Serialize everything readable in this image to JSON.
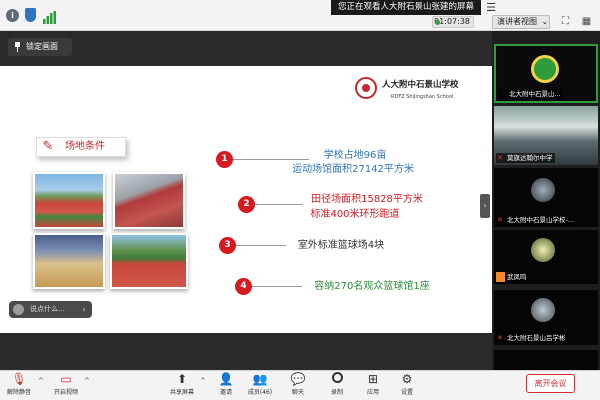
{
  "top_bar": {
    "share_banner": "您正在观看人大附石景山张建的屏幕",
    "timer": "01:07:38",
    "view_button": "演讲者视图",
    "view_caret": "⌄",
    "menu_icon": "☰",
    "info_icon": "i",
    "shield_icon": "shield",
    "signal_icon": "signal-bars",
    "fullscreen_icon": "⛶",
    "grid_icon": "▦"
  },
  "slide": {
    "lock_button": "锁定画面",
    "lock_icon": "📌",
    "school_name": "人大附中石景山学校",
    "school_name_en": "RDFZ Shijingshan School",
    "heading": "场地条件",
    "heading_icon": "✎",
    "points": [
      {
        "number": "1",
        "lines": [
          "学校占地96亩",
          "运动场馆面积27142平方米"
        ],
        "color": "#2f74c0"
      },
      {
        "number": "2",
        "lines": [
          "田径场面积15828平方米",
          "标准400米环形跑道"
        ],
        "color": "#d71920"
      },
      {
        "number": "3",
        "lines": [
          "室外标准篮球场4块"
        ],
        "color": "#333333"
      },
      {
        "number": "4",
        "lines": [
          "容纳270名观众篮球馆1座"
        ],
        "color": "#2e8b3a"
      }
    ]
  },
  "chat": {
    "placeholder": "说点什么...",
    "arrow": "‹"
  },
  "panel_toggle": "›",
  "participants": [
    {
      "name": "北大附中石景山...",
      "muted": false
    },
    {
      "name": "莫旗达翰尔中学",
      "muted": true
    },
    {
      "name": "北大附中石景山学校-...",
      "muted": true
    },
    {
      "name": "武凤鸣",
      "muted": false
    },
    {
      "name": "北大附石景山吕学彬",
      "muted": true
    },
    {
      "name": "",
      "muted": false
    }
  ],
  "toolbar": {
    "unmute": "解除静音",
    "start_video": "开启视频",
    "share_screen": "共享屏幕",
    "invite": "邀请",
    "members": "成员(46)",
    "chat": "聊天",
    "record": "录制",
    "apps": "应用",
    "settings": "设置",
    "end_meeting": "离开会议",
    "caret": "^"
  },
  "colors": {
    "accent_red": "#d71920",
    "blue_text": "#2f74c0",
    "green_text": "#2e8b3a"
  }
}
